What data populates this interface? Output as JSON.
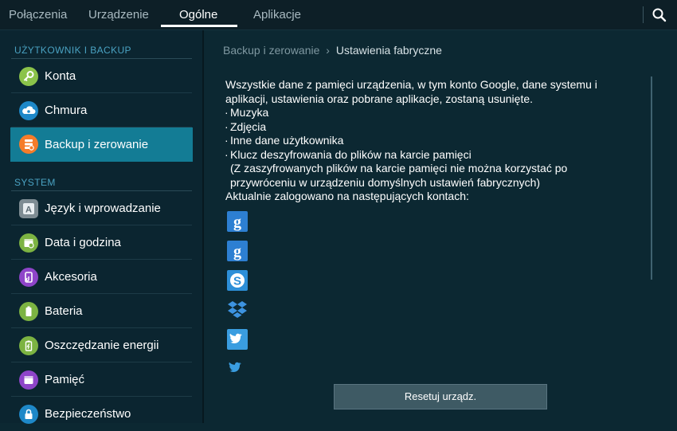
{
  "tabs": [
    {
      "label": "Połączenia"
    },
    {
      "label": "Urządzenie"
    },
    {
      "label": "Ogólne"
    },
    {
      "label": "Aplikacje"
    }
  ],
  "colors": {
    "accent": "#137c95",
    "section_header": "#4aa2c2",
    "background": "#0c2832"
  },
  "sidebar": {
    "section1": "UŻYTKOWNIK I BACKUP",
    "section2": "SYSTEM",
    "items": [
      {
        "label": "Konta",
        "icon": "key-icon"
      },
      {
        "label": "Chmura",
        "icon": "cloud-icon"
      },
      {
        "label": "Backup i zerowanie",
        "icon": "backup-icon",
        "selected": true
      },
      {
        "label": "Język i wprowadzanie",
        "icon": "language-icon"
      },
      {
        "label": "Data i godzina",
        "icon": "calendar-icon"
      },
      {
        "label": "Akcesoria",
        "icon": "accessory-icon"
      },
      {
        "label": "Bateria",
        "icon": "battery-icon"
      },
      {
        "label": "Oszczędzanie energii",
        "icon": "power-saving-icon"
      },
      {
        "label": "Pamięć",
        "icon": "storage-icon"
      },
      {
        "label": "Bezpieczeństwo",
        "icon": "lock-icon"
      }
    ]
  },
  "breadcrumb": {
    "parent": "Backup i zerowanie",
    "separator": "›",
    "current": "Ustawienia fabryczne"
  },
  "content": {
    "intro": "Wszystkie dane z pamięci urządzenia, w tym konto Google, dane systemu i aplikacji, ustawienia oraz pobrane aplikacje, zostaną usunięte.",
    "bullets": [
      "Muzyka",
      "Zdjęcia",
      "Inne dane użytkownika",
      "Klucz deszyfrowania do plików na karcie pamięci"
    ],
    "note": "(Z zaszyfrowanych plików na karcie pamięci nie można korzystać po przywróceniu w urządzeniu domyślnych ustawień fabrycznych)",
    "accounts_label": "Aktualnie zalogowano na następujących kontach:",
    "accounts": [
      {
        "icon": "google-icon"
      },
      {
        "icon": "google-icon"
      },
      {
        "icon": "skype-icon"
      },
      {
        "icon": "dropbox-icon"
      },
      {
        "icon": "twitter-icon"
      },
      {
        "icon": "twitter-icon"
      }
    ],
    "reset_button": "Resetuj urządz."
  }
}
